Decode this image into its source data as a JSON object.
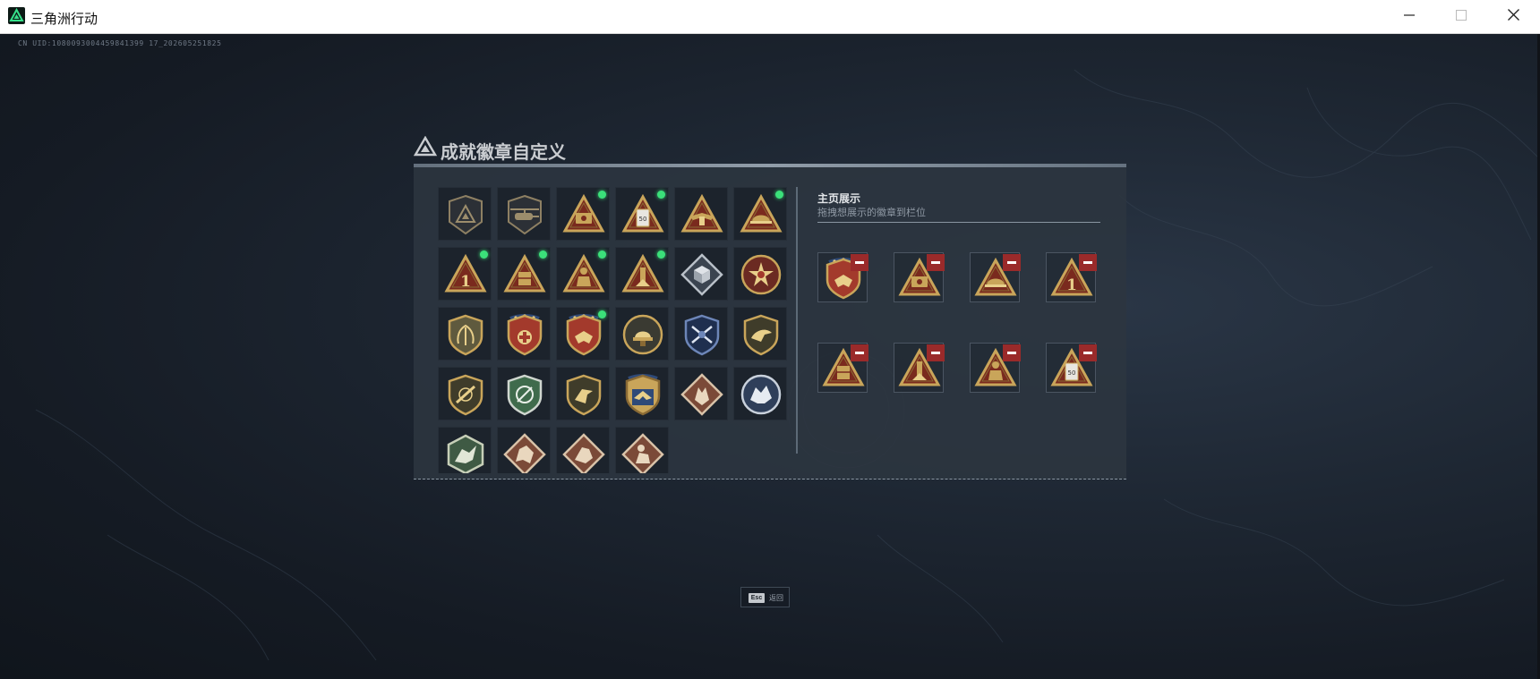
{
  "window": {
    "title": "三角洲行动",
    "minimize_icon": "minimize-icon",
    "maximize_icon": "maximize-icon",
    "close_icon": "close-icon"
  },
  "uid_text": "CN UID:1080093004459841399 17_202605251825",
  "panel": {
    "title": "成就徽章自定义",
    "title_icon": "delta-triangle-icon"
  },
  "badge_grid": [
    {
      "icon": "delta-shield-badge-icon",
      "new": false
    },
    {
      "icon": "helicopter-shield-badge-icon",
      "new": false
    },
    {
      "icon": "gold-triangle-cash-badge-icon",
      "new": true
    },
    {
      "icon": "gold-triangle-card-badge-icon",
      "new": true
    },
    {
      "icon": "gold-triangle-wings-badge-icon",
      "new": false
    },
    {
      "icon": "gold-triangle-helmet-badge-icon",
      "new": true
    },
    {
      "icon": "gold-triangle-number-one-badge-icon",
      "new": true
    },
    {
      "icon": "gold-triangle-crate-badge-icon",
      "new": true
    },
    {
      "icon": "gold-triangle-soldier-badge-icon",
      "new": true
    },
    {
      "icon": "gold-triangle-tower-badge-icon",
      "new": true
    },
    {
      "icon": "silver-diamond-cube-badge-icon",
      "new": false
    },
    {
      "icon": "red-star-emblem-badge-icon",
      "new": false
    },
    {
      "icon": "olive-shield-wreath-badge-icon",
      "new": false
    },
    {
      "icon": "star-shield-cross-badge-icon",
      "new": false
    },
    {
      "icon": "star-shield-eagle-badge-icon",
      "new": true
    },
    {
      "icon": "round-helmet-badge-icon",
      "new": false
    },
    {
      "icon": "blue-shield-rifles-badge-icon",
      "new": false
    },
    {
      "icon": "olive-shield-eagle-badge-icon",
      "new": false
    },
    {
      "icon": "olive-shield-rifle-badge-icon",
      "new": false
    },
    {
      "icon": "green-shield-wreath-badge-icon",
      "new": false
    },
    {
      "icon": "olive-shield-hawk-badge-icon",
      "new": false
    },
    {
      "icon": "blue-shield-eagle-badge-icon",
      "new": false
    },
    {
      "icon": "red-diamond-wolf-badge-icon",
      "new": false
    },
    {
      "icon": "round-wolf-badge-icon",
      "new": false
    },
    {
      "icon": "green-hexagon-dragon-badge-icon",
      "new": false
    },
    {
      "icon": "red-diamond-dragon-badge-icon",
      "new": false
    },
    {
      "icon": "red-diamond-beast-badge-icon",
      "new": false
    },
    {
      "icon": "red-diamond-soldier-badge-icon",
      "new": false
    }
  ],
  "homepage_display": {
    "title": "主页展示",
    "subtitle": "拖拽想展示的徽章到栏位",
    "slots": [
      {
        "icon": "star-shield-eagle-badge-icon",
        "remove_icon": "minus-icon"
      },
      {
        "icon": "gold-triangle-cash-badge-icon",
        "remove_icon": "minus-icon"
      },
      {
        "icon": "gold-triangle-helmet-badge-icon",
        "remove_icon": "minus-icon"
      },
      {
        "icon": "gold-triangle-number-one-badge-icon",
        "remove_icon": "minus-icon"
      },
      {
        "icon": "gold-triangle-crate-badge-icon",
        "remove_icon": "minus-icon"
      },
      {
        "icon": "gold-triangle-tower-badge-icon",
        "remove_icon": "minus-icon"
      },
      {
        "icon": "gold-triangle-soldier-badge-icon",
        "remove_icon": "minus-icon"
      },
      {
        "icon": "gold-triangle-card-badge-icon",
        "remove_icon": "minus-icon"
      }
    ]
  },
  "footer": {
    "esc_key": "Esc",
    "back_label": "返回"
  },
  "colors": {
    "accent_green": "#3be07a",
    "remove_red": "#9a2a2a",
    "badge_gold": "#c9a55a"
  }
}
